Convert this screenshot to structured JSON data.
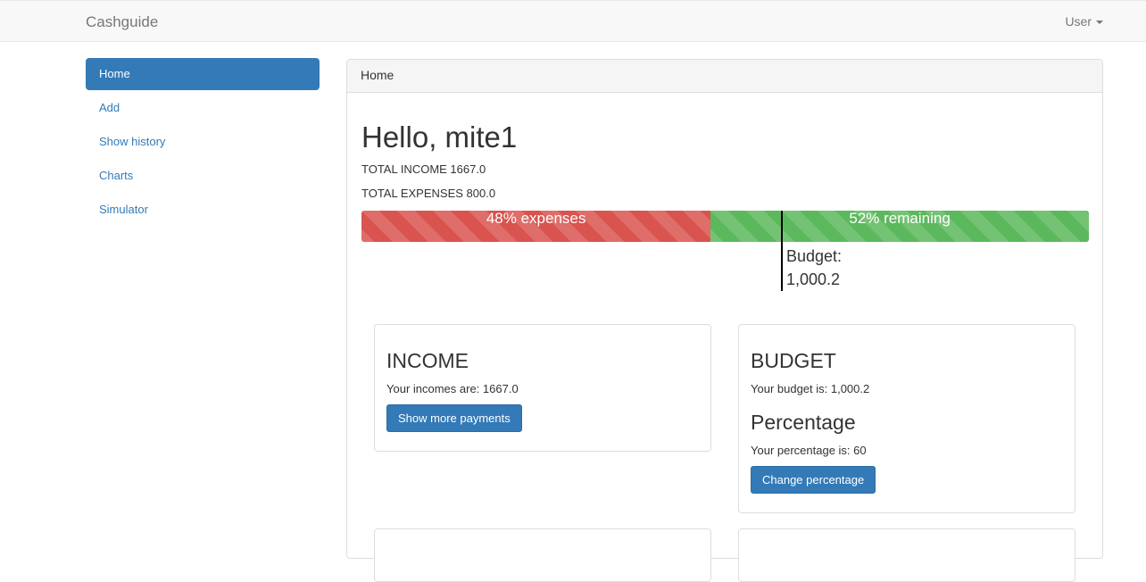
{
  "navbar": {
    "brand": "Cashguide",
    "user": "User"
  },
  "sidebar": {
    "items": [
      {
        "label": "Home"
      },
      {
        "label": "Add"
      },
      {
        "label": "Show history"
      },
      {
        "label": "Charts"
      },
      {
        "label": "Simulator"
      }
    ]
  },
  "panel": {
    "heading": "Home",
    "greeting": "Hello, mite1",
    "total_income": "TOTAL INCOME 1667.0",
    "total_expenses": "TOTAL EXPENSES 800.0",
    "progress": {
      "expenses_label": "48% expenses",
      "expenses_percent": 48,
      "remaining_label": "52% remaining",
      "remaining_percent": 52,
      "budget_title": "Budget:",
      "budget_value": "1,000.2"
    },
    "income_card": {
      "title": "INCOME",
      "text": "Your incomes are: 1667.0",
      "button": "Show more payments"
    },
    "budget_card": {
      "title": "BUDGET",
      "text": "Your budget is: 1,000.2",
      "percentage_title": "Percentage",
      "percentage_text": "Your percentage is: 60",
      "button": "Change percentage"
    }
  },
  "colors": {
    "primary": "#337ab7",
    "danger": "#d9534f",
    "success": "#5cb85c"
  }
}
